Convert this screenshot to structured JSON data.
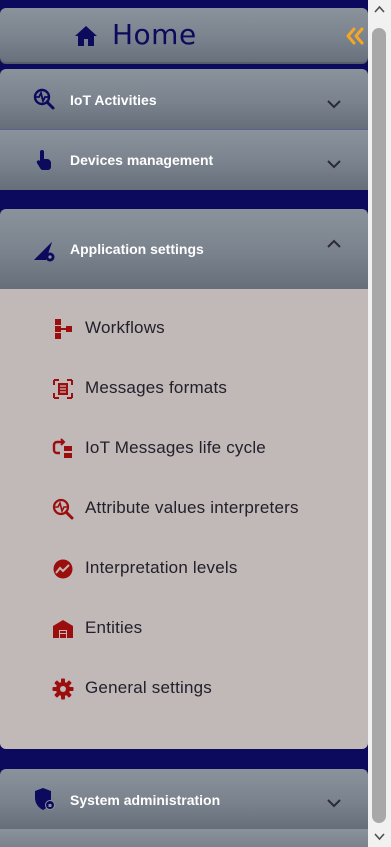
{
  "home": {
    "label": "Home"
  },
  "sections": [
    {
      "label": "IoT Activities",
      "icon": "search-pulse-icon",
      "expanded": false
    },
    {
      "label": "Devices management",
      "icon": "touch-hand-icon",
      "expanded": false
    },
    {
      "label": "Application settings",
      "icon": "settings-triangle-icon",
      "expanded": true
    },
    {
      "label": "System administration",
      "icon": "shield-lock-icon",
      "expanded": false
    }
  ],
  "app_settings_items": [
    {
      "label": "Workflows",
      "icon": "workflow-icon"
    },
    {
      "label": "Messages formats",
      "icon": "document-frame-icon"
    },
    {
      "label": "IoT Messages life cycle",
      "icon": "cycle-icon"
    },
    {
      "label": "Attribute values interpreters",
      "icon": "search-wave-icon"
    },
    {
      "label": "Interpretation levels",
      "icon": "chart-badge-icon"
    },
    {
      "label": "Entities",
      "icon": "warehouse-icon"
    },
    {
      "label": "General settings",
      "icon": "gear-icon"
    }
  ],
  "colors": {
    "background": "#0c0a5c",
    "accent": "#f5a623",
    "submenu_icon": "#9c0d0d",
    "submenu_bg": "#c1b8b8"
  }
}
